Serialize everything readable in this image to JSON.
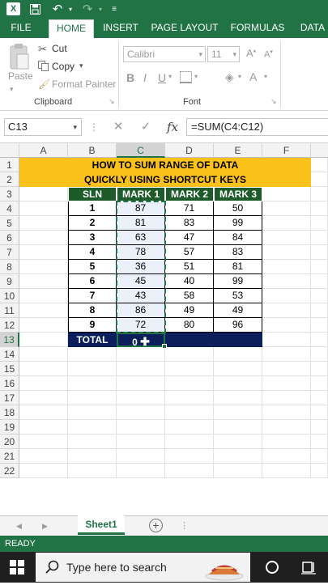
{
  "quick_access": {
    "icons": [
      "excel-icon",
      "save-icon",
      "undo-icon",
      "redo-icon",
      "customize-icon"
    ]
  },
  "ribbon_tabs": [
    "FILE",
    "HOME",
    "INSERT",
    "PAGE LAYOUT",
    "FORMULAS",
    "DATA"
  ],
  "active_tab": "HOME",
  "clipboard": {
    "paste": "Paste",
    "cut": "Cut",
    "copy": "Copy",
    "format_painter": "Format Painter",
    "group": "Clipboard"
  },
  "font": {
    "name": "Calibri",
    "size": "11",
    "group": "Font"
  },
  "formula_bar": {
    "name_box": "C13",
    "formula": "=SUM(C4:C12)"
  },
  "columns": [
    "A",
    "B",
    "C",
    "D",
    "E",
    "F"
  ],
  "rows": [
    "1",
    "2",
    "3",
    "4",
    "5",
    "6",
    "7",
    "8",
    "9",
    "10",
    "11",
    "12",
    "13",
    "14",
    "15",
    "16",
    "17",
    "18",
    "19",
    "20",
    "21",
    "22"
  ],
  "sheet": {
    "title_line1": "HOW TO SUM RANGE OF DATA",
    "title_line2": "QUICKLY USING SHORTCUT KEYS",
    "headers": [
      "SLN",
      "MARK 1",
      "MARK 2",
      "MARK 3"
    ],
    "data": [
      [
        "1",
        "87",
        "71",
        "50"
      ],
      [
        "2",
        "81",
        "83",
        "99"
      ],
      [
        "3",
        "63",
        "47",
        "84"
      ],
      [
        "4",
        "78",
        "57",
        "83"
      ],
      [
        "5",
        "36",
        "51",
        "81"
      ],
      [
        "6",
        "45",
        "40",
        "99"
      ],
      [
        "7",
        "43",
        "58",
        "53"
      ],
      [
        "8",
        "86",
        "49",
        "49"
      ],
      [
        "9",
        "72",
        "80",
        "96"
      ]
    ],
    "total_label": "TOTAL",
    "total_value": "0"
  },
  "sheet_tabs": {
    "active": "Sheet1"
  },
  "status": "READY",
  "taskbar": {
    "search_placeholder": "Type here to search"
  },
  "colors": {
    "excel_green": "#217346",
    "title_band": "#fcc21c",
    "header_green": "#1e5b2a",
    "total_navy": "#0c1f5c"
  }
}
